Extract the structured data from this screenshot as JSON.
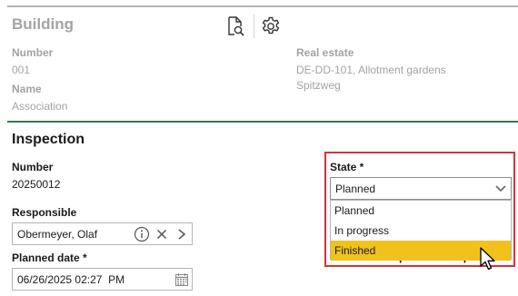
{
  "building": {
    "title": "Building",
    "number_label": "Number",
    "number_value": "001",
    "name_label": "Name",
    "name_value": "Association",
    "real_estate_label": "Real estate",
    "real_estate_line1": "DE-DD-101, Allotment gardens",
    "real_estate_line2": "Spitzweg",
    "toolbar": {
      "preview_icon": "document-search-icon",
      "settings_icon": "gear-icon"
    }
  },
  "inspection": {
    "title": "Inspection",
    "number_label": "Number",
    "number_value": "20250012",
    "responsible_label": "Responsible",
    "responsible_value": "Obermeyer, Olaf",
    "planned_date_label": "Planned date *",
    "planned_date_value": "06/26/2025 02:27  PM",
    "hidden_label_partial": "Assessment previous inspecti"
  },
  "state": {
    "label": "State *",
    "selected": "Planned",
    "options": [
      "Planned",
      "In progress",
      "Finished"
    ],
    "hovered_option": "Finished"
  },
  "colors": {
    "section_rule": "#2e7d4f",
    "highlight_border": "#d6333a",
    "hover_option": "#f1c21b"
  }
}
